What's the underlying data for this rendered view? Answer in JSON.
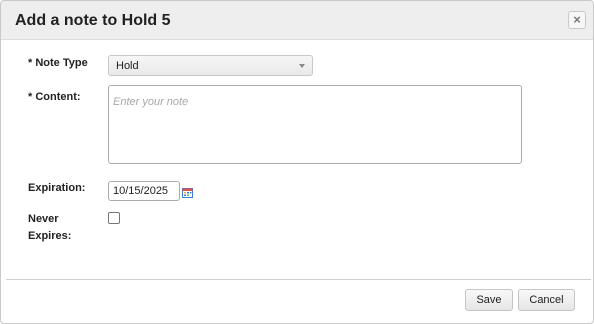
{
  "dialog": {
    "title": "Add a note to Hold 5",
    "close_glyph": "×",
    "close_icon": "close-icon"
  },
  "form": {
    "note_type": {
      "label": "* Note Type",
      "selected": "Hold"
    },
    "content": {
      "label": "* Content:",
      "value": "",
      "placeholder": "Enter your note"
    },
    "expiration": {
      "label": "Expiration:",
      "value": "10/15/2025",
      "icon": "calendar-icon"
    },
    "never_expires": {
      "label_line1": "Never",
      "label_line2": "Expires:",
      "checked": false
    }
  },
  "footer": {
    "save_label": "Save",
    "cancel_label": "Cancel"
  },
  "colors": {
    "titlebar_bg": "#eeeeee",
    "border": "#c9c9c9",
    "placeholder": "#a8a8a8",
    "calendar_red": "#d9534f",
    "calendar_blue": "#3a7bd5"
  }
}
